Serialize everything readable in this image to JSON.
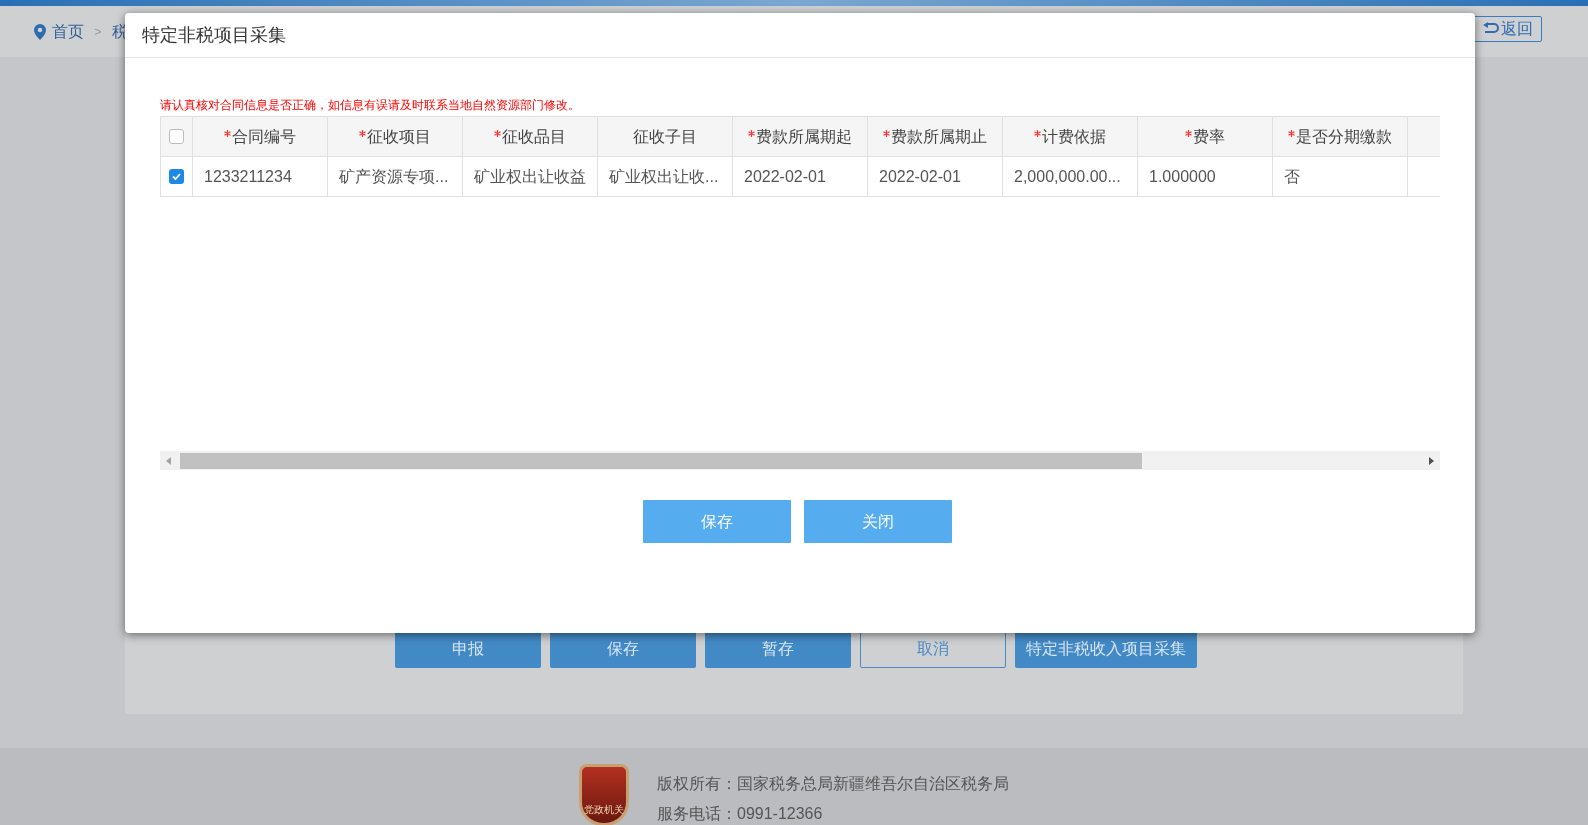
{
  "breadcrumb": {
    "home": "首页",
    "separator": ">",
    "current": "税"
  },
  "back_button": "返回",
  "page_buttons": [
    {
      "label": "申报",
      "kind": "primary"
    },
    {
      "label": "保存",
      "kind": "primary"
    },
    {
      "label": "暂存",
      "kind": "primary"
    },
    {
      "label": "取消",
      "kind": "outline"
    },
    {
      "label": "特定非税收入项目采集",
      "kind": "primary"
    }
  ],
  "footer": {
    "logo_text": "党政机关",
    "copyright": "版权所有：国家税务总局新疆维吾尔自治区税务局",
    "phone": "服务电话：0991-12366"
  },
  "dialog": {
    "title": "特定非税项目采集",
    "notice": "请认真核对合同信息是否正确，如信息有误请及时联系当地自然资源部门修改。",
    "table": {
      "header_checked": false,
      "columns": [
        {
          "label": "合同编号",
          "required": true
        },
        {
          "label": "征收项目",
          "required": true
        },
        {
          "label": "征收品目",
          "required": true
        },
        {
          "label": "征收子目",
          "required": false
        },
        {
          "label": "费款所属期起",
          "required": true
        },
        {
          "label": "费款所属期止",
          "required": true
        },
        {
          "label": "计费依据",
          "required": true
        },
        {
          "label": "费率",
          "required": true
        },
        {
          "label": "是否分期缴款",
          "required": true
        }
      ],
      "rows": [
        {
          "checked": true,
          "cells": [
            "1233211234",
            "矿产资源专项...",
            "矿业权出让收益",
            "矿业权出让收...",
            "2022-02-01",
            "2022-02-01",
            "2,000,000.00...",
            "1.000000",
            "否"
          ]
        }
      ]
    },
    "buttons": [
      "保存",
      "关闭"
    ]
  }
}
